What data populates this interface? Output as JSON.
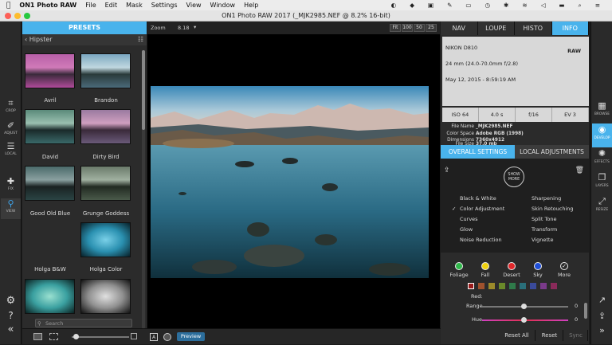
{
  "menubar": {
    "app_name": "ON1 Photo RAW",
    "items": [
      "File",
      "Edit",
      "Mask",
      "Settings",
      "View",
      "Window",
      "Help"
    ]
  },
  "window": {
    "title": "ON1 Photo RAW 2017 (_MJK2985.NEF @ 8.2% 16-bit)"
  },
  "left_tools": [
    {
      "label": "CROP",
      "icon": "crop-icon"
    },
    {
      "label": "ADJUST",
      "icon": "brush-icon"
    },
    {
      "label": "LOCAL",
      "icon": "sliders-icon"
    },
    {
      "label": "FIX",
      "icon": "bandaid-icon"
    },
    {
      "label": "VIEW",
      "icon": "magnifier-icon"
    }
  ],
  "presets": {
    "header": "PRESETS",
    "category": "Hipster",
    "items": [
      {
        "label": "Avril"
      },
      {
        "label": "Brandon"
      },
      {
        "label": "David"
      },
      {
        "label": "Dirty Bird"
      },
      {
        "label": "Good Old Blue"
      },
      {
        "label": "Grunge Goddess"
      },
      {
        "label": "Holga B&W"
      },
      {
        "label": "Holga Color"
      }
    ],
    "search_placeholder": "Search"
  },
  "viewer": {
    "zoom_label": "Zoom",
    "zoom_value": "8.18",
    "zoom_buttons": [
      "Fit",
      "100",
      "50",
      "25"
    ],
    "preview_label": "Preview"
  },
  "right_panel": {
    "tabs": [
      "NAV",
      "LOUPE",
      "HISTO",
      "INFO"
    ],
    "active_tab": "INFO",
    "camera": "NIKON D810",
    "format": "RAW",
    "lens": "24 mm (24.0-70.0mm f/2.8)",
    "date": "May 12, 2015 - 8:59:19 AM",
    "exposure": [
      "ISO 64",
      "4.0 s",
      "f/16",
      "EV 3"
    ],
    "meta": [
      {
        "key": "File Name",
        "value": "_MJK2985.NEF"
      },
      {
        "key": "Color Space",
        "value": "Adobe RGB (1998)"
      },
      {
        "key": "Dimensions",
        "value": "7360x4912"
      },
      {
        "key": "File Size",
        "value": "37.0 mb"
      }
    ],
    "settings_tabs": [
      "OVERALL SETTINGS",
      "LOCAL ADJUSTMENTS"
    ],
    "show_more": "SHOW MORE",
    "filters_left": [
      "Black & White",
      "Color Adjustment",
      "Curves",
      "Glow",
      "Noise Reduction"
    ],
    "filters_right": [
      "Sharpening",
      "Skin Retouching",
      "Split Tone",
      "Transform",
      "Vignette"
    ],
    "checked_filter": "✓",
    "color_targets": [
      {
        "label": "Foliage",
        "color": "#2fb84a"
      },
      {
        "label": "Fall",
        "color": "#f0d20f"
      },
      {
        "label": "Desert",
        "color": "#e0282b"
      },
      {
        "label": "Sky",
        "color": "#1f4fd8"
      },
      {
        "label": "More",
        "color": "#2b2b2b"
      }
    ],
    "swatches": [
      "#9a1a1a",
      "#a0522d",
      "#9b8b2a",
      "#6a8a2a",
      "#2f7a4a",
      "#2a6f7a",
      "#3a4a9a",
      "#7a3a8a",
      "#8a2a5a"
    ],
    "selected_color_label": "Red:",
    "range_label": "Range",
    "range_value": "0",
    "hue_label": "Hue",
    "hue_value": "0"
  },
  "bottom_buttons": {
    "reset_all": "Reset All",
    "reset": "Reset",
    "sync": "Sync"
  },
  "modules": [
    {
      "label": "BROWSE",
      "icon": "browse-icon"
    },
    {
      "label": "DEVELOP",
      "icon": "develop-icon"
    },
    {
      "label": "EFFECTS",
      "icon": "effects-icon"
    },
    {
      "label": "LAYERS",
      "icon": "layers-icon"
    },
    {
      "label": "RESIZE",
      "icon": "resize-icon"
    }
  ],
  "colors": {
    "accent": "#49b3ec",
    "panel": "#2b2b2b"
  }
}
